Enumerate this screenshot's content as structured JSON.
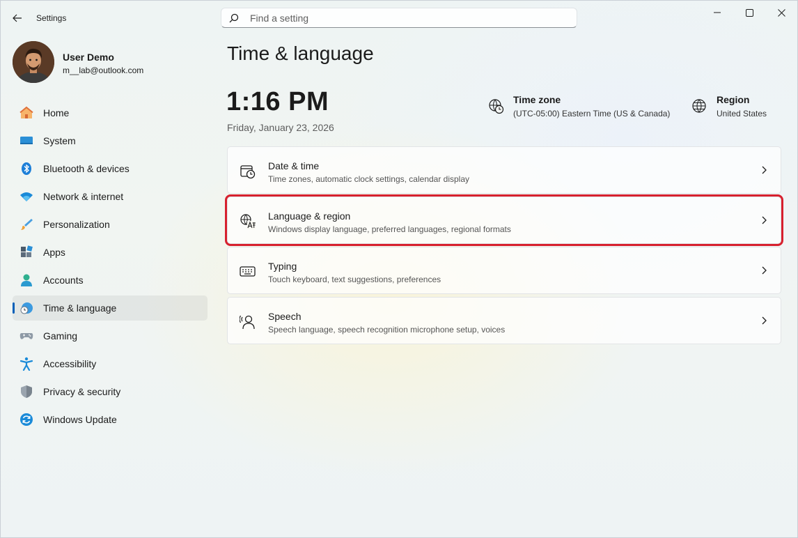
{
  "app": {
    "title": "Settings"
  },
  "search": {
    "placeholder": "Find a setting"
  },
  "user": {
    "name": "User Demo",
    "email": "m__lab@outlook.com"
  },
  "nav": {
    "items": [
      {
        "label": "Home",
        "icon": "home-icon"
      },
      {
        "label": "System",
        "icon": "system-icon"
      },
      {
        "label": "Bluetooth & devices",
        "icon": "bluetooth-icon"
      },
      {
        "label": "Network & internet",
        "icon": "wifi-icon"
      },
      {
        "label": "Personalization",
        "icon": "brush-icon"
      },
      {
        "label": "Apps",
        "icon": "apps-icon"
      },
      {
        "label": "Accounts",
        "icon": "accounts-icon"
      },
      {
        "label": "Time & language",
        "icon": "time-language-icon",
        "selected": true
      },
      {
        "label": "Gaming",
        "icon": "gamepad-icon"
      },
      {
        "label": "Accessibility",
        "icon": "accessibility-icon"
      },
      {
        "label": "Privacy & security",
        "icon": "shield-icon"
      },
      {
        "label": "Windows Update",
        "icon": "update-icon"
      }
    ]
  },
  "main": {
    "title": "Time & language",
    "time": "1:16 PM",
    "date": "Friday, January 23, 2026",
    "timezone": {
      "label": "Time zone",
      "value": "(UTC-05:00) Eastern Time (US & Canada)"
    },
    "region": {
      "label": "Region",
      "value": "United States"
    },
    "cards": [
      {
        "title": "Date & time",
        "subtitle": "Time zones, automatic clock settings, calendar display",
        "icon": "calendar-clock-icon"
      },
      {
        "title": "Language & region",
        "subtitle": "Windows display language, preferred languages, regional formats",
        "icon": "language-icon",
        "highlighted": true
      },
      {
        "title": "Typing",
        "subtitle": "Touch keyboard, text suggestions, preferences",
        "icon": "keyboard-icon"
      },
      {
        "title": "Speech",
        "subtitle": "Speech language, speech recognition microphone setup, voices",
        "icon": "speech-icon"
      }
    ]
  },
  "colors": {
    "accent": "#005fb8",
    "highlight": "#d7202e"
  }
}
